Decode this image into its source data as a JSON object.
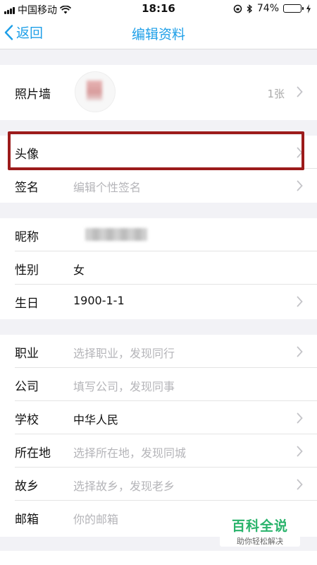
{
  "status_bar": {
    "carrier": "中国移动",
    "time": "18:16",
    "battery_percent": "74%",
    "battery_level": 0.74
  },
  "nav": {
    "back_label": "返回",
    "title": "编辑资料"
  },
  "photo_wall": {
    "label": "照片墙",
    "count": "1张"
  },
  "profile_rows": [
    {
      "label": "头像",
      "value": ""
    },
    {
      "label": "签名",
      "value": "编辑个性签名"
    }
  ],
  "basic_rows": [
    {
      "label": "昵称",
      "value": ""
    },
    {
      "label": "性别",
      "value": "女"
    },
    {
      "label": "生日",
      "value": "1900-1-1"
    }
  ],
  "detail_rows": [
    {
      "label": "职业",
      "value": "选择职业，发现同行"
    },
    {
      "label": "公司",
      "value": "填写公司，发现同事"
    },
    {
      "label": "学校",
      "value": "中华人民"
    },
    {
      "label": "所在地",
      "value": "选择所在地，发现同城"
    },
    {
      "label": "故乡",
      "value": "选择故乡，发现老乡"
    },
    {
      "label": "邮箱",
      "value": "你的邮箱"
    }
  ],
  "watermark": {
    "title": "百科全说",
    "subtitle": "助你轻松解决"
  }
}
